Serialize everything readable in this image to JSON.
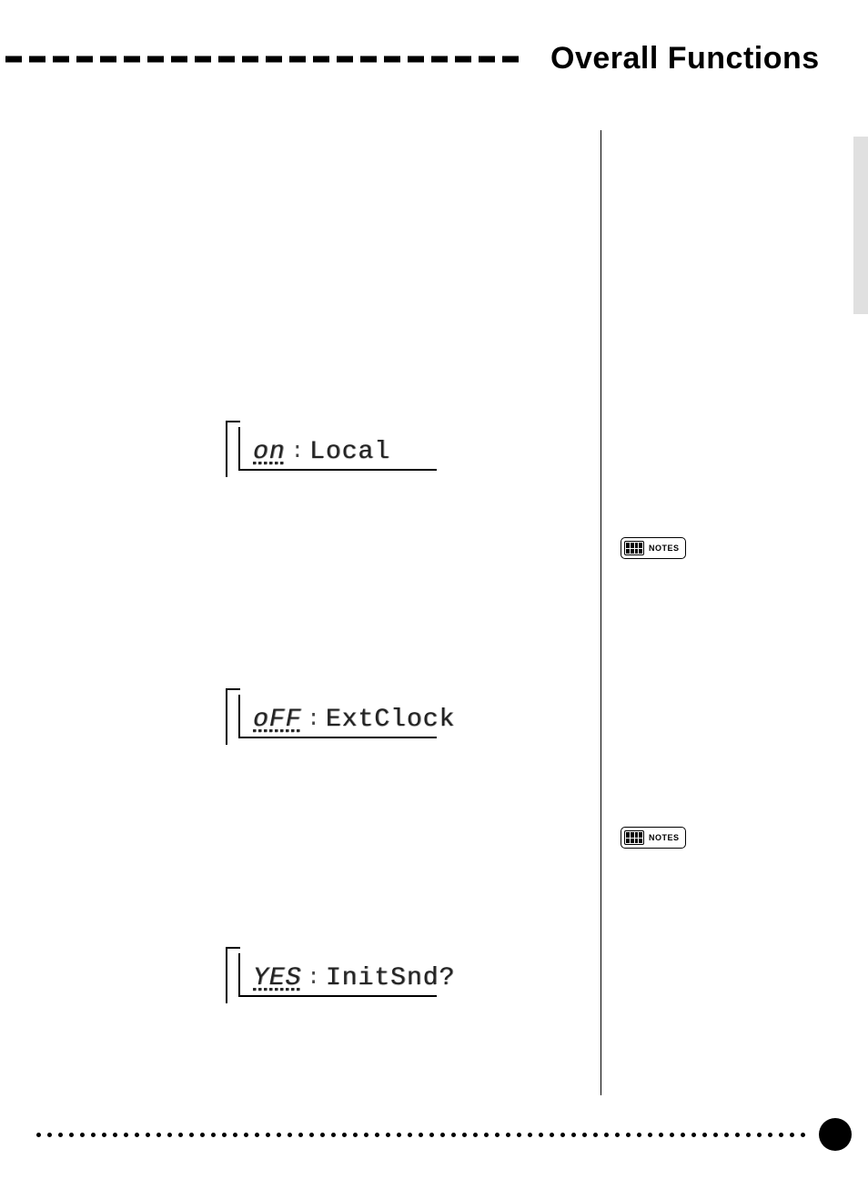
{
  "header": {
    "title": "Overall Functions"
  },
  "lcds": {
    "local": {
      "value": "on",
      "label": "Local"
    },
    "extclock": {
      "value": "oFF",
      "label": "ExtClock"
    },
    "initsnd": {
      "value": "YES",
      "label": "InitSnd?"
    }
  },
  "notesLabel": "NOTES"
}
